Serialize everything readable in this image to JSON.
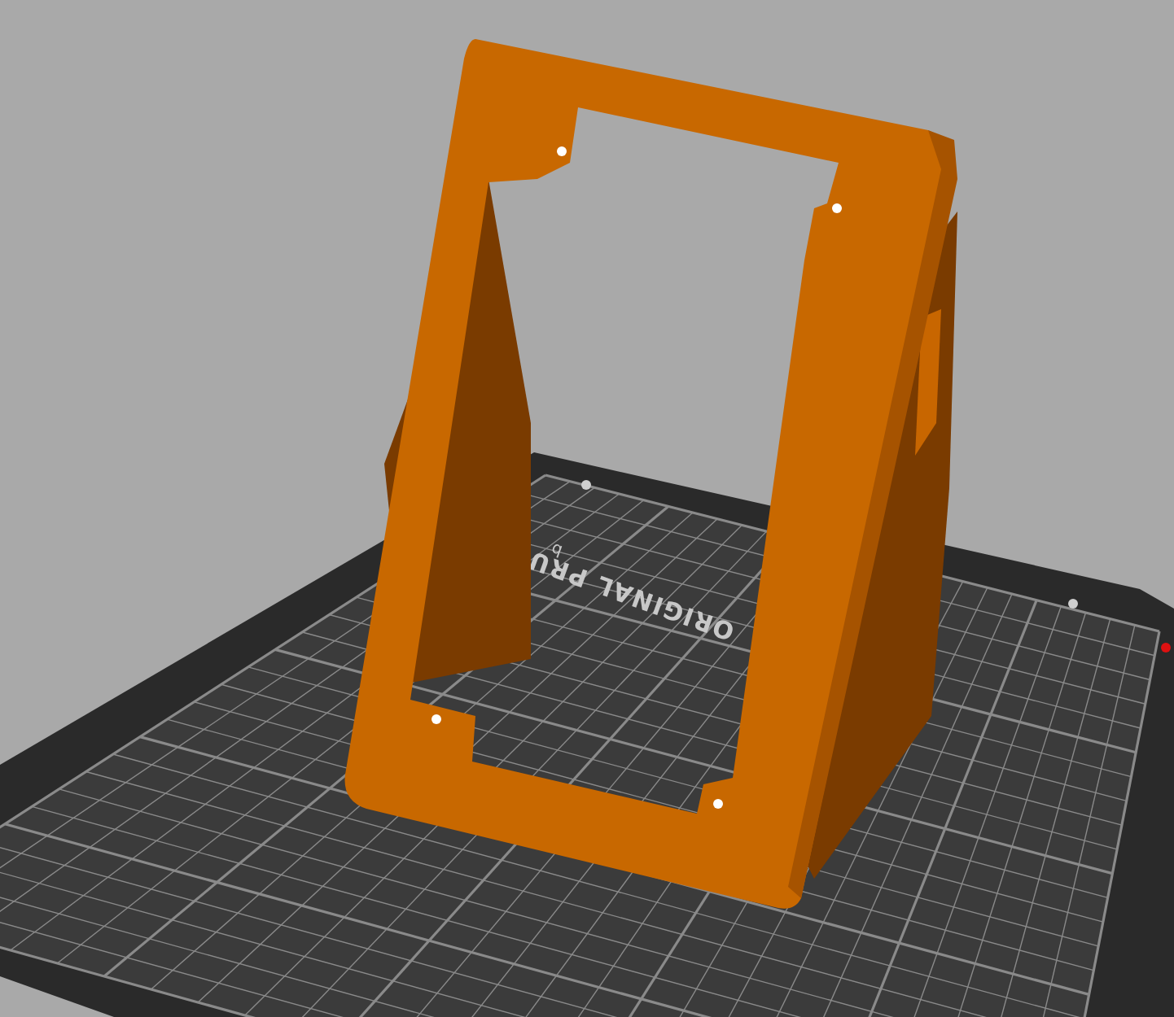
{
  "viewport": {
    "bed_label": "ORIGINAL PRU",
    "bed_sublabel": "b"
  }
}
